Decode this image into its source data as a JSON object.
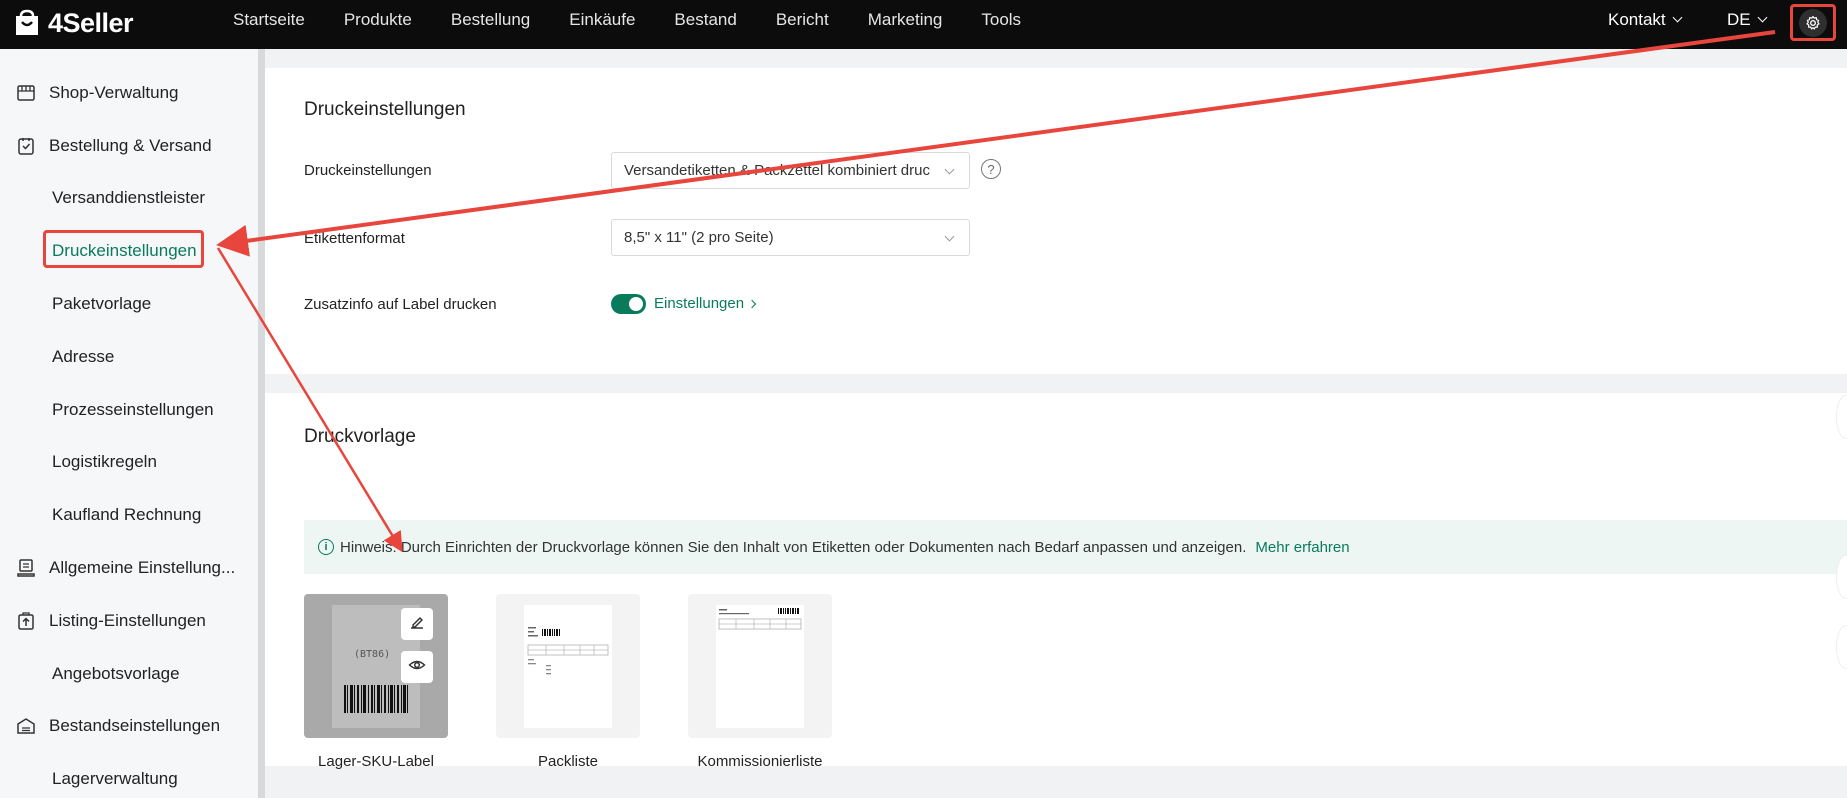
{
  "app": {
    "name": "4Seller"
  },
  "nav": {
    "items": [
      "Startseite",
      "Produkte",
      "Bestellung",
      "Einkäufe",
      "Bestand",
      "Bericht",
      "Marketing",
      "Tools"
    ],
    "contact": "Kontakt",
    "language": "DE"
  },
  "sidebar": {
    "shop": "Shop-Verwaltung",
    "order": "Bestellung & Versand",
    "carriers": "Versanddienstleister",
    "print": "Druckeinstellungen",
    "package": "Paketvorlage",
    "address": "Adresse",
    "process": "Prozesseinstellungen",
    "logistics": "Logistikregeln",
    "kaufland": "Kaufland Rechnung",
    "general": "Allgemeine Einstellung...",
    "listing": "Listing-Einstellungen",
    "offer": "Angebotsvorlage",
    "stock": "Bestandseinstellungen",
    "warehouse": "Lagerverwaltung"
  },
  "print_settings": {
    "title": "Druckeinstellungen",
    "mode_label": "Druckeinstellungen",
    "mode_value": "Versandetiketten & Packzettel kombiniert druc",
    "format_label": "Etikettenformat",
    "format_value": "8,5\" x 11\" (2 pro Seite)",
    "extra_label": "Zusatzinfo auf Label drucken",
    "extra_enabled": true,
    "settings_link": "Einstellungen"
  },
  "templates": {
    "title": "Druckvorlage",
    "hint": "Hinweis: Durch Einrichten der Druckvorlage können Sie den Inhalt von Etiketten oder Dokumenten nach Bedarf anpassen und anzeigen.",
    "hint_link": "Mehr erfahren",
    "items": [
      {
        "label": "Lager-SKU-Label",
        "preview_text": "(BT86)"
      },
      {
        "label": "Packliste"
      },
      {
        "label": "Kommissionierliste"
      }
    ]
  },
  "colors": {
    "accent": "#0a7a5c",
    "annotation": "#e8453c",
    "topbar": "#0c0c0c"
  },
  "icons": [
    "logo-icon",
    "gear-icon",
    "shop-icon",
    "order-icon",
    "general-icon",
    "listing-icon",
    "stock-icon",
    "help-icon",
    "info-icon",
    "edit-icon",
    "eye-icon"
  ]
}
